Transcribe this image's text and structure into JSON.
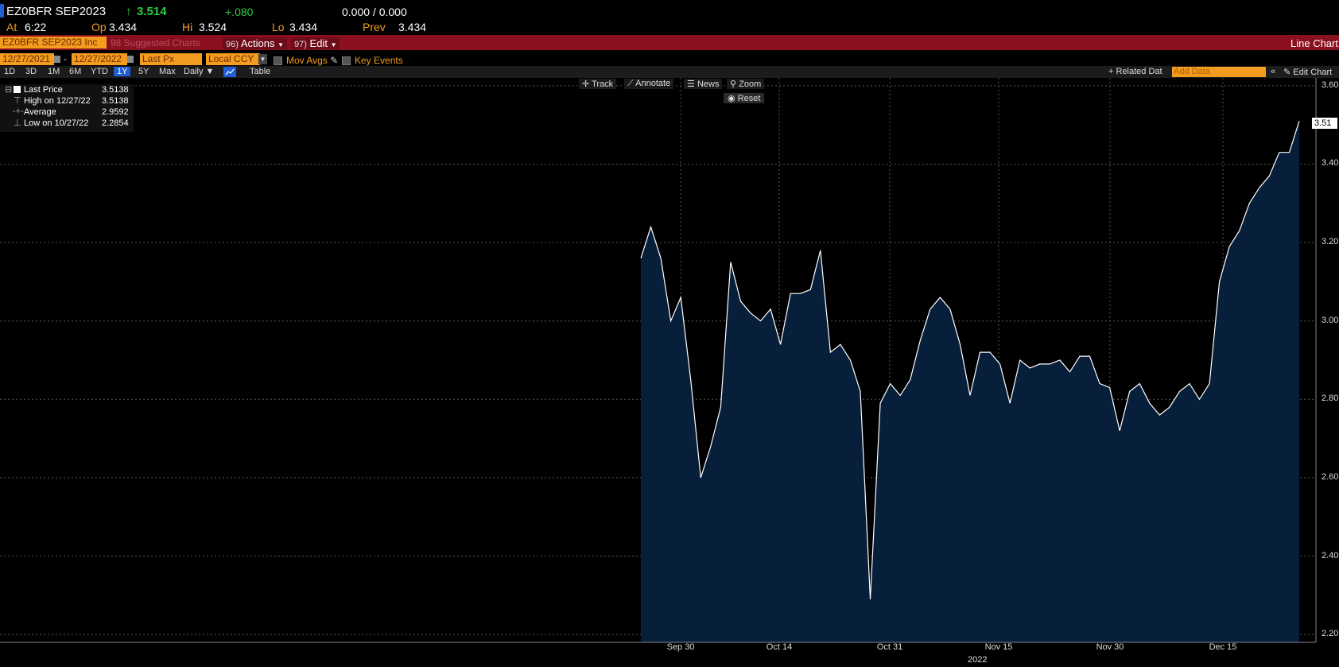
{
  "header": {
    "ticker": "EZ0BFR SEP2023",
    "last_arrow": "↑",
    "last": "3.514",
    "change": "+.080",
    "bid_ask": "0.000 / 0.000",
    "at_label": "At",
    "at_time": "6:22",
    "op_label": "Op",
    "op": "3.434",
    "hi_label": "Hi",
    "hi": "3.524",
    "lo_label": "Lo",
    "lo": "3.434",
    "prev_label": "Prev",
    "prev": "3.434"
  },
  "toolbar": {
    "security": "EZ0BFR SEP2023 Inc",
    "suggested": "98 Suggested Charts",
    "actions_num": "96)",
    "actions": "Actions",
    "edit_num": "97)",
    "edit": "Edit",
    "title": "Line Chart"
  },
  "controls": {
    "start_date": "12/27/2021",
    "end_date": "12/27/2022",
    "field": "Last Px",
    "currency": "Local CCY",
    "mov_avgs": "Mov Avgs",
    "key_events": "Key Events"
  },
  "ranges": [
    "1D",
    "3D",
    "1M",
    "6M",
    "YTD",
    "1Y",
    "5Y",
    "Max"
  ],
  "range_selected": "1Y",
  "frequency": "Daily",
  "table_label": "Table",
  "related_data": "Related Dat",
  "add_data_placeholder": "Add Data",
  "edit_chart": "Edit Chart",
  "chart_tools": {
    "track": "Track",
    "annotate": "Annotate",
    "news": "News",
    "zoom": "Zoom",
    "reset": "Reset"
  },
  "legend": [
    {
      "label": "Last Price",
      "value": "3.5138"
    },
    {
      "label": "High on 12/27/22",
      "value": "3.5138"
    },
    {
      "label": "Average",
      "value": "2.9592"
    },
    {
      "label": "Low on 10/27/22",
      "value": "2.2854"
    }
  ],
  "colors": {
    "accent_orange": "#f39c1f",
    "toolbar_red": "#8a1020",
    "area_fill": "#081f3b",
    "line": "#ffffff",
    "change_green": "#2ecc40"
  },
  "chart_data": {
    "type": "area",
    "title": "",
    "xlabel": "2022",
    "ylabel": "",
    "ylim": [
      2.18,
      3.62
    ],
    "yticks": [
      "3.60",
      "3.40",
      "3.20",
      "3.00",
      "2.80",
      "2.60",
      "2.40",
      "2.20"
    ],
    "xticks": [
      "Sep 30",
      "Oct 14",
      "Oct 31",
      "Nov 15",
      "Nov 30",
      "Dec 15"
    ],
    "x_year_label": "2022",
    "last_value_label": "3.51",
    "grid": true,
    "series": [
      {
        "values": [
          3.16,
          3.24,
          3.16,
          3.0,
          3.06,
          2.85,
          2.6,
          2.68,
          2.78,
          3.15,
          3.05,
          3.02,
          3.0,
          3.03,
          2.94,
          3.07,
          3.07,
          3.08,
          3.18,
          2.92,
          2.94,
          2.9,
          2.82,
          2.29,
          2.79,
          2.84,
          2.81,
          2.85,
          2.95,
          3.03,
          3.06,
          3.03,
          2.94,
          2.81,
          2.92,
          2.92,
          2.89,
          2.79,
          2.9,
          2.88,
          2.89,
          2.89,
          2.9,
          2.87,
          2.91,
          2.91,
          2.84,
          2.83,
          2.72,
          2.82,
          2.84,
          2.79,
          2.76,
          2.78,
          2.82,
          2.84,
          2.8,
          2.84,
          3.1,
          3.19,
          3.23,
          3.3,
          3.34,
          3.37,
          3.43,
          3.43,
          3.51
        ]
      }
    ]
  }
}
